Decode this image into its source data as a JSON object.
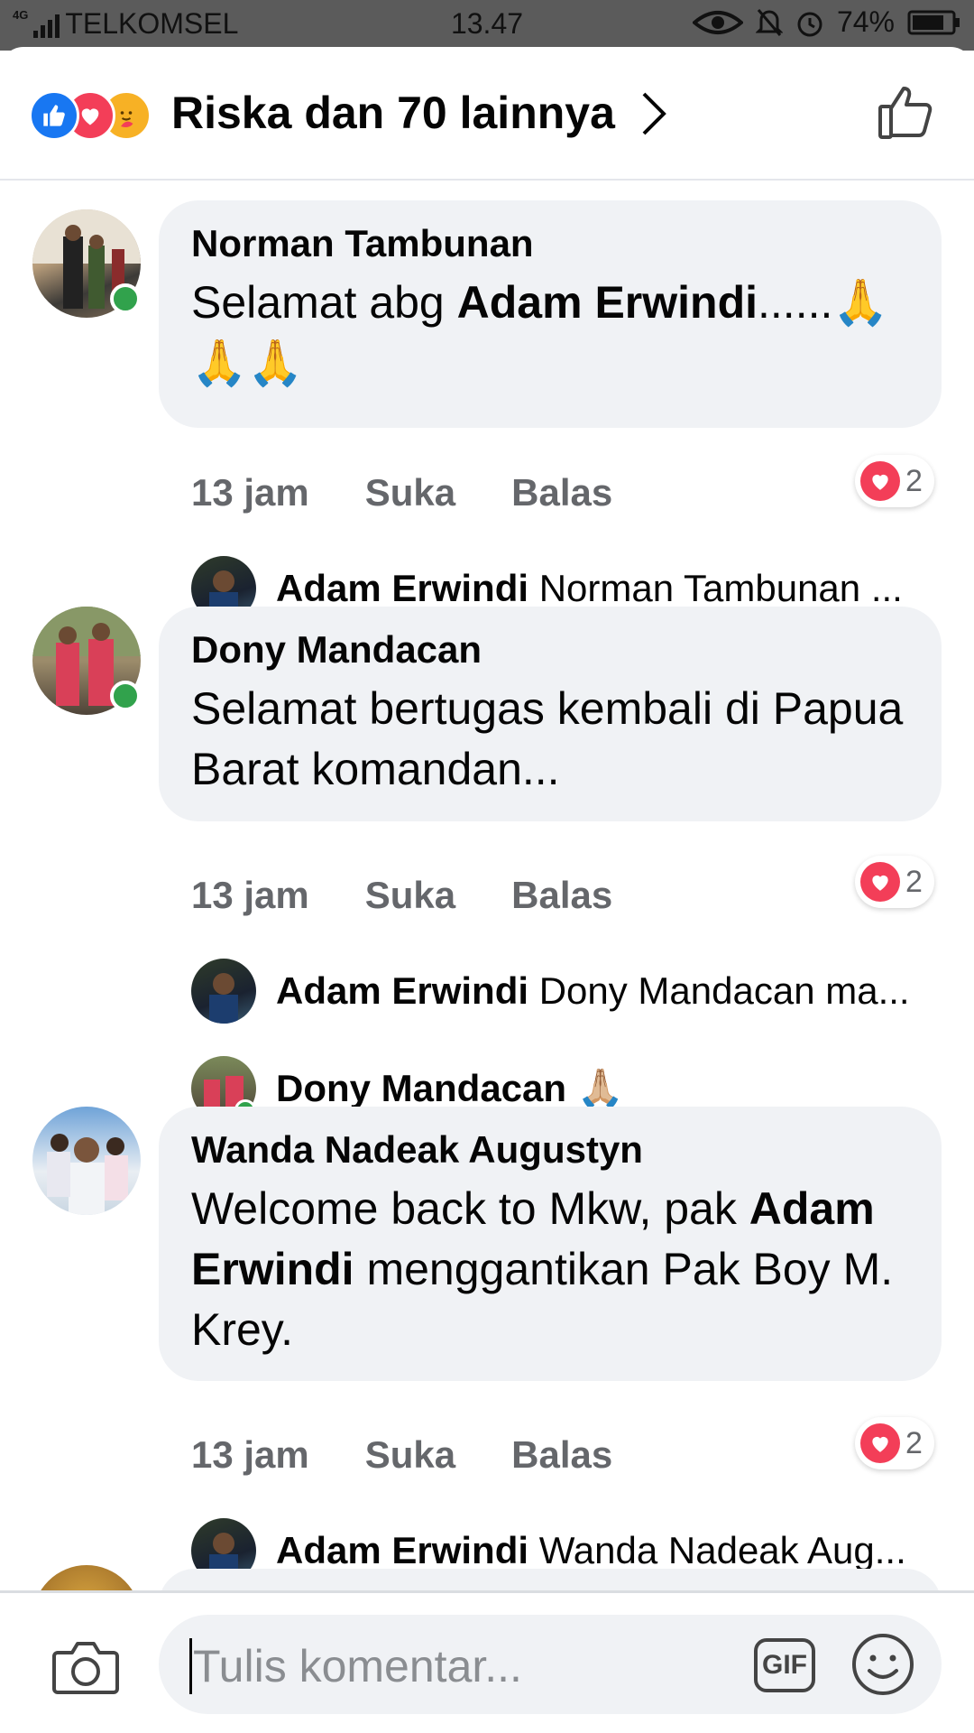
{
  "status_bar": {
    "network": "4G",
    "carrier": "TELKOMSEL",
    "time": "13.47",
    "battery": "74%"
  },
  "reactions": {
    "summary": "Riska dan 70 lainnya",
    "icons": [
      "like-icon",
      "love-icon",
      "care-icon"
    ]
  },
  "comments": [
    {
      "author": "Norman Tambunan",
      "text_before": "Selamat abg ",
      "text_bold": "Adam Erwindi",
      "text_after": "......🙏🙏🙏",
      "time": "13 jam",
      "like_label": "Suka",
      "reply_label": "Balas",
      "reaction_count": "2",
      "online": true,
      "replies": [
        {
          "author": "Adam Erwindi",
          "text": "Norman Tambunan ..."
        }
      ]
    },
    {
      "author": "Dony Mandacan",
      "text_before": "Selamat bertugas kembali di Papua Barat komandan...",
      "time": "13 jam",
      "like_label": "Suka",
      "reply_label": "Balas",
      "reaction_count": "2",
      "online": true,
      "replies": [
        {
          "author": "Adam Erwindi",
          "text": "Dony Mandacan ma..."
        },
        {
          "author": "Dony Mandacan",
          "text": "🙏🏼"
        }
      ]
    },
    {
      "author": "Wanda Nadeak Augustyn",
      "text_before": "Welcome back to Mkw, pak ",
      "text_bold": "Adam Erwindi",
      "text_after": " menggantikan Pak Boy M. Krey.",
      "time": "13 jam",
      "like_label": "Suka",
      "reply_label": "Balas",
      "reaction_count": "2",
      "online": false,
      "replies": [
        {
          "author": "Adam Erwindi",
          "text": "Wanda Nadeak Aug..."
        }
      ]
    }
  ],
  "composer": {
    "placeholder": "Tulis komentar...",
    "gif_label": "GIF"
  },
  "colors": {
    "like_blue": "#1877f2",
    "love_red": "#f33e58",
    "bubble_bg": "#f0f2f5",
    "online_green": "#31a24c",
    "meta_gray": "#65676b"
  }
}
